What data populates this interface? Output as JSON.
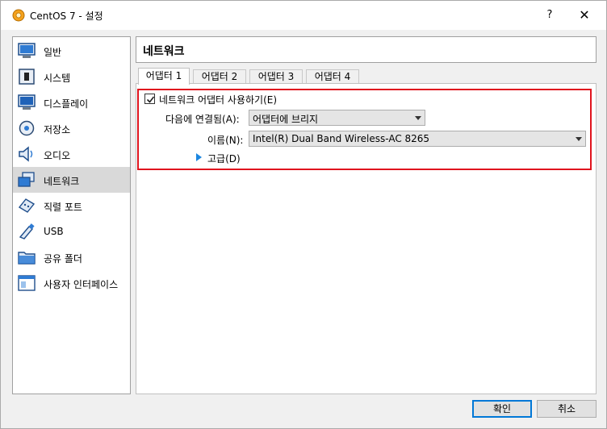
{
  "window": {
    "title": "CentOS 7 - 설정",
    "help_label": "?",
    "close_label": "✕"
  },
  "sidebar": {
    "items": [
      {
        "label": "일반",
        "icon": "general-icon"
      },
      {
        "label": "시스템",
        "icon": "system-icon"
      },
      {
        "label": "디스플레이",
        "icon": "display-icon"
      },
      {
        "label": "저장소",
        "icon": "storage-icon"
      },
      {
        "label": "오디오",
        "icon": "audio-icon"
      },
      {
        "label": "네트워크",
        "icon": "network-icon",
        "selected": true
      },
      {
        "label": "직렬 포트",
        "icon": "serial-port-icon"
      },
      {
        "label": "USB",
        "icon": "usb-icon"
      },
      {
        "label": "공유 폴더",
        "icon": "shared-folder-icon"
      },
      {
        "label": "사용자 인터페이스",
        "icon": "user-interface-icon"
      }
    ]
  },
  "page": {
    "title": "네트워크"
  },
  "tabs": [
    {
      "label": "어댑터 1",
      "active": true
    },
    {
      "label": "어댑터 2"
    },
    {
      "label": "어댑터 3"
    },
    {
      "label": "어댑터 4"
    }
  ],
  "adapter": {
    "enable_label": "네트워크 어댑터 사용하기(E)",
    "enabled": true,
    "attached_label": "다음에 연결됨(A):",
    "attached_value": "어댑터에 브리지",
    "name_label": "이름(N):",
    "name_value": "Intel(R) Dual Band Wireless-AC 8265",
    "advanced_label": "고급(D)"
  },
  "buttons": {
    "ok_label": "확인",
    "cancel_label": "취소"
  },
  "colors": {
    "highlight": "#e0141e",
    "accent": "#0078d7",
    "expander": "#1c86e0"
  }
}
